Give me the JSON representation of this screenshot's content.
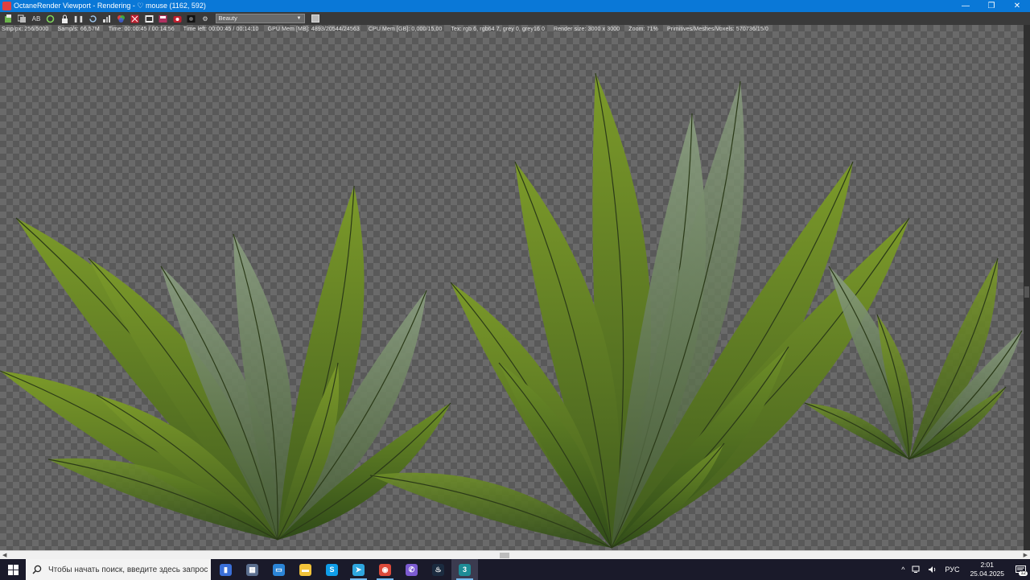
{
  "window": {
    "title": "OctaneRender Viewport - Rendering - ♡ mouse (1162, 592)",
    "minimize_glyph": "—",
    "maximize_glyph": "❐",
    "close_glyph": "✕"
  },
  "toolbar": {
    "buttons": [
      {
        "name": "import-icon",
        "glyph": ""
      },
      {
        "name": "copy-icon",
        "glyph": ""
      },
      {
        "name": "ab-compare-icon",
        "glyph": "AB"
      },
      {
        "name": "restart-render-icon",
        "glyph": ""
      },
      {
        "name": "lock-icon",
        "glyph": ""
      },
      {
        "name": "pause-icon",
        "glyph": "❚❚"
      },
      {
        "name": "reset-icon",
        "glyph": ""
      },
      {
        "name": "clay-mode-icon",
        "glyph": ""
      },
      {
        "name": "color-picker-icon",
        "glyph": ""
      },
      {
        "name": "region-render-icon",
        "glyph": ""
      },
      {
        "name": "film-region-icon",
        "glyph": ""
      },
      {
        "name": "save-image-icon",
        "glyph": ""
      },
      {
        "name": "camera-view-icon",
        "glyph": ""
      },
      {
        "name": "settings-icon",
        "glyph": "⚙"
      }
    ],
    "render_pass": "Beauty"
  },
  "status": {
    "samples": "Smp/px: 256/5000",
    "samp_speed": "Samp/s: 66,57M",
    "time": "Time: 00:00:45 / 00:14:56",
    "time_left": "Time left: 00:00:45 / 00:14:10",
    "gpu_mem": "GPU Mem [MB]: 4893/20544/24563",
    "cpu_mem": "CPU Mem [GB]: 0,000/15,00",
    "tex": "Tex: rgb 6, rgb64 7, grey 0, grey16 0",
    "render_size": "Render size: 3000 x 3000",
    "zoom": "Zoom: 71%",
    "primitives": "Primitives/Meshes/Voxels: 570736/15/0"
  },
  "taskbar": {
    "search_placeholder": "Чтобы начать поиск, введите здесь запрос",
    "apps": [
      {
        "name": "taskbar-app-notepad",
        "color": "#3a6fd8",
        "glyph": "▮",
        "running": false,
        "active": false
      },
      {
        "name": "taskbar-app-photos",
        "color": "#5b6f8f",
        "glyph": "▦",
        "running": false,
        "active": false
      },
      {
        "name": "taskbar-app-computer",
        "color": "#2b84d6",
        "glyph": "▭",
        "running": false,
        "active": false
      },
      {
        "name": "taskbar-app-explorer",
        "color": "#f2c33a",
        "glyph": "▬",
        "running": false,
        "active": false
      },
      {
        "name": "taskbar-app-skype",
        "color": "#0f9de8",
        "glyph": "S",
        "running": false,
        "active": false
      },
      {
        "name": "taskbar-app-telegram",
        "color": "#2ea6df",
        "glyph": "➤",
        "running": true,
        "active": false
      },
      {
        "name": "taskbar-app-chrome",
        "color": "#dc4a3b",
        "glyph": "◉",
        "running": true,
        "active": false
      },
      {
        "name": "taskbar-app-viber",
        "color": "#7c5bd1",
        "glyph": "✆",
        "running": false,
        "active": false
      },
      {
        "name": "taskbar-app-steam",
        "color": "#1b2b3f",
        "glyph": "♨",
        "running": false,
        "active": false
      },
      {
        "name": "taskbar-app-3dsmax",
        "color": "#1e8c96",
        "glyph": "3",
        "running": true,
        "active": true
      }
    ],
    "tray_chevron": "^",
    "language": "РУС",
    "time": "2:01",
    "date": "25.04.2025",
    "notifications": "12"
  }
}
